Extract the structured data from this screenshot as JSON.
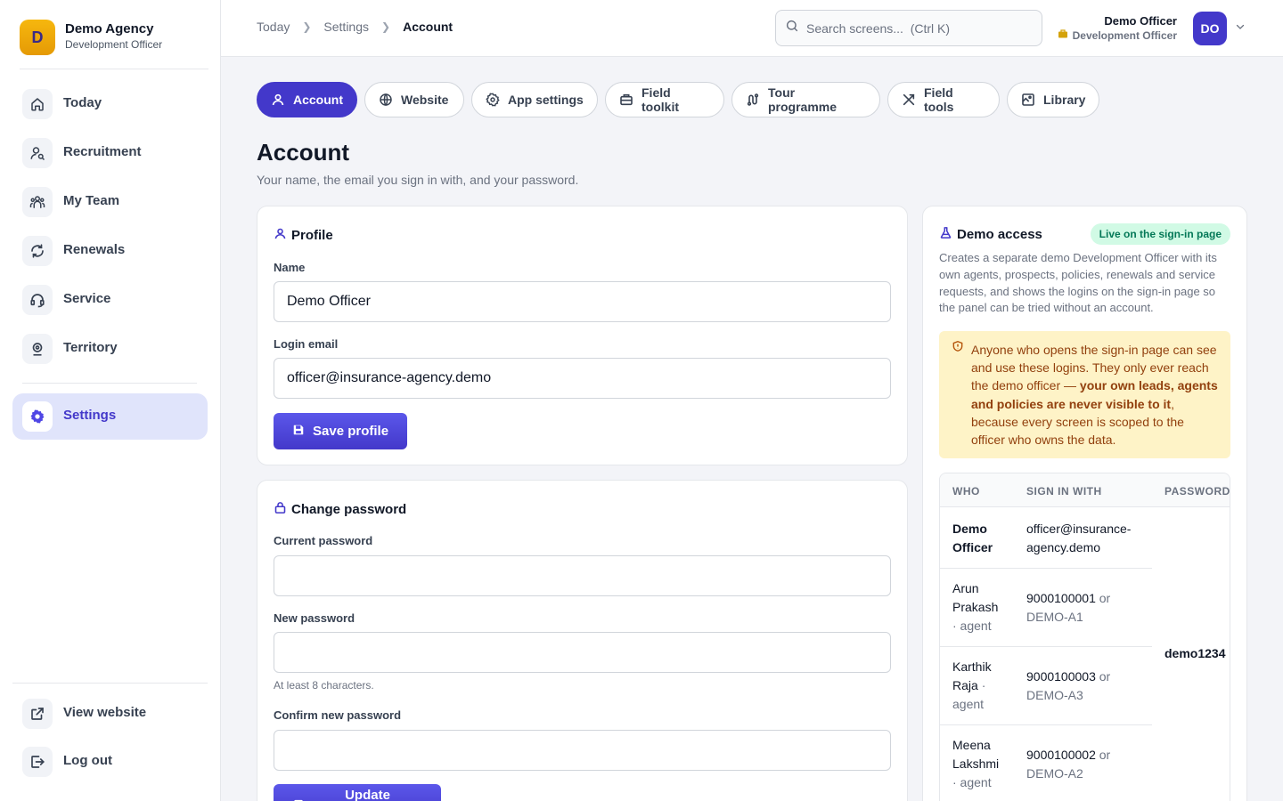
{
  "brand": {
    "logo_letter": "D",
    "name": "Demo Agency",
    "role": "Development Officer"
  },
  "sidebar": {
    "items": [
      {
        "label": "Today",
        "icon": "home-icon"
      },
      {
        "label": "Recruitment",
        "icon": "user-search-icon"
      },
      {
        "label": "My Team",
        "icon": "team-icon"
      },
      {
        "label": "Renewals",
        "icon": "refresh-icon"
      },
      {
        "label": "Service",
        "icon": "headset-icon"
      },
      {
        "label": "Territory",
        "icon": "map-pin-icon"
      },
      {
        "label": "Settings",
        "icon": "gear-icon",
        "active": true
      }
    ],
    "bottom": [
      {
        "label": "View website",
        "icon": "external-link-icon"
      },
      {
        "label": "Log out",
        "icon": "logout-icon"
      }
    ]
  },
  "topbar": {
    "breadcrumb": [
      "Today",
      "Settings",
      "Account"
    ],
    "search_placeholder": "Search screens...  (Ctrl K)",
    "user_name": "Demo Officer",
    "user_role": "Development Officer",
    "avatar_initials": "DO"
  },
  "tabs": [
    {
      "label": "Account",
      "icon": "user-icon",
      "active": true
    },
    {
      "label": "Website",
      "icon": "globe-icon"
    },
    {
      "label": "App settings",
      "icon": "gear-icon"
    },
    {
      "label": "Field toolkit",
      "icon": "briefcase-icon"
    },
    {
      "label": "Tour programme",
      "icon": "route-icon"
    },
    {
      "label": "Field tools",
      "icon": "tools-icon"
    },
    {
      "label": "Library",
      "icon": "library-icon"
    }
  ],
  "page": {
    "title": "Account",
    "subtitle": "Your name, the email you sign in with, and your password."
  },
  "profile": {
    "title": "Profile",
    "name_label": "Name",
    "name_value": "Demo Officer",
    "email_label": "Login email",
    "email_value": "officer@insurance-agency.demo",
    "save_label": "Save profile"
  },
  "password": {
    "title": "Change password",
    "current_label": "Current password",
    "new_label": "New password",
    "hint": "At least 8 characters.",
    "confirm_label": "Confirm new password",
    "update_label": "Update password"
  },
  "demo": {
    "title": "Demo access",
    "badge": "Live on the sign-in page",
    "description": "Creates a separate demo Development Officer with its own agents, prospects, policies, renewals and service requests, and shows the logins on the sign-in page so the panel can be tried without an account.",
    "warning_pre": "Anyone who opens the sign-in page can see and use these logins. They only ever reach the demo officer — ",
    "warning_bold": "your own leads, agents and policies are never visible to it",
    "warning_post": ", because every screen is scoped to the officer who owns the data.",
    "headers": {
      "who": "WHO",
      "sign": "SIGN IN WITH",
      "password": "PASSWORD"
    },
    "password_value": "demo1234",
    "rows": [
      {
        "who": "Demo Officer",
        "role": "",
        "sign": "officer@insurance-agency.demo",
        "or": "",
        "code": ""
      },
      {
        "who": "Arun Prakash",
        "role": "· agent",
        "sign": "9000100001",
        "or": "or",
        "code": "DEMO-A1"
      },
      {
        "who": "Karthik Raja",
        "role": "· agent",
        "sign": "9000100003",
        "or": "or",
        "code": "DEMO-A3"
      },
      {
        "who": "Meena Lakshmi",
        "role": "· agent",
        "sign": "9000100002",
        "or": "or",
        "code": "DEMO-A2"
      }
    ]
  }
}
